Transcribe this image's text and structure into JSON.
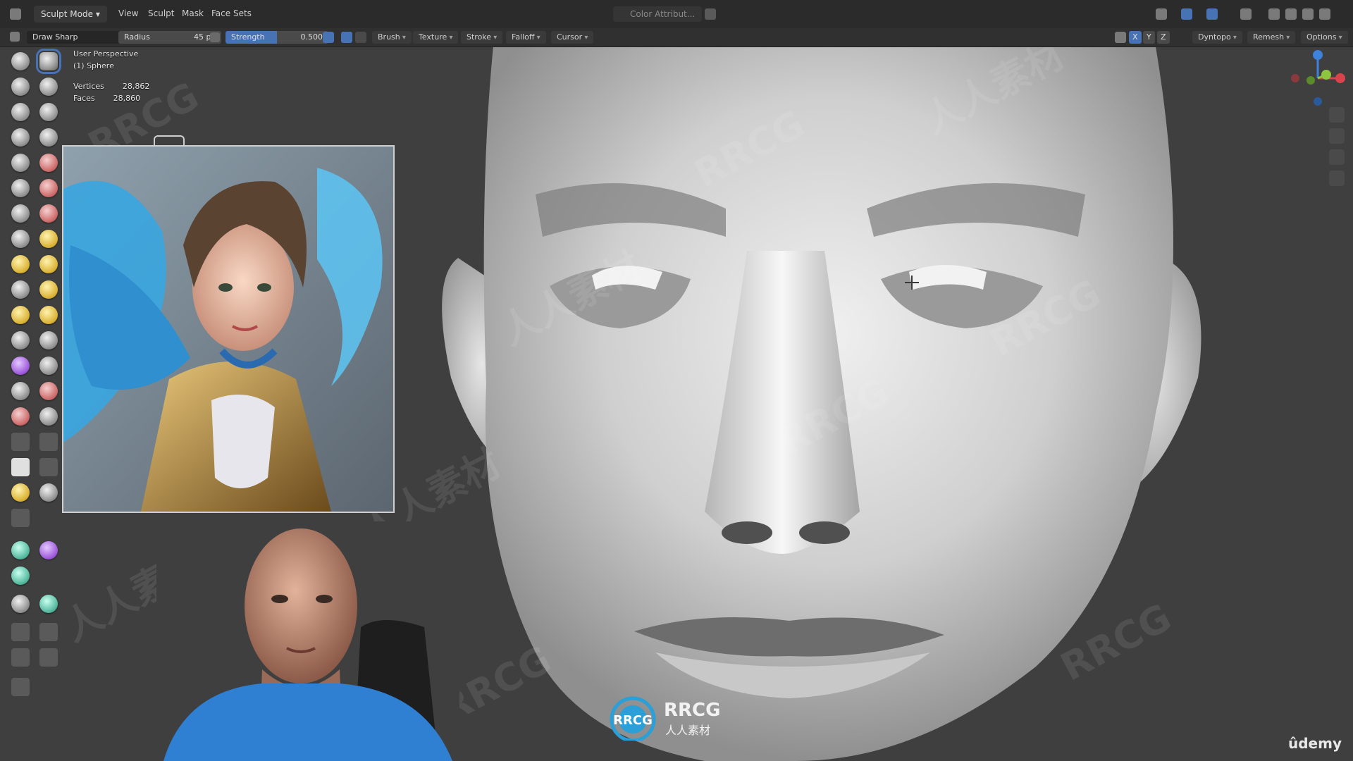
{
  "header": {
    "mode_label": "Sculpt Mode",
    "menus": [
      "View",
      "Sculpt",
      "Mask",
      "Face Sets"
    ],
    "color_attribute_label": "Color Attribut..."
  },
  "tool_settings": {
    "brush_name": "Draw Sharp",
    "radius_label": "Radius",
    "radius_value": "45 px",
    "strength_label": "Strength",
    "strength_value": "0.500",
    "menus": [
      "Brush",
      "Texture",
      "Stroke",
      "Falloff",
      "Cursor"
    ],
    "axes": [
      "X",
      "Y",
      "Z"
    ],
    "right_menus": [
      "Dyntopo",
      "Remesh",
      "Options"
    ]
  },
  "viewport": {
    "perspective": "User Perspective",
    "object": "(1) Sphere",
    "vertices_label": "Vertices",
    "vertices_value": "28,862",
    "faces_label": "Faces",
    "faces_value": "28,860"
  },
  "watermark": {
    "text_en": "RRCG",
    "text_cn": "人人素材"
  },
  "brand": {
    "udemy": "ûdemy"
  },
  "colors": {
    "accent": "#4772b3",
    "gizmo_x": "#d9434b",
    "gizmo_y": "#8dc63f",
    "gizmo_z": "#3f82d9"
  }
}
